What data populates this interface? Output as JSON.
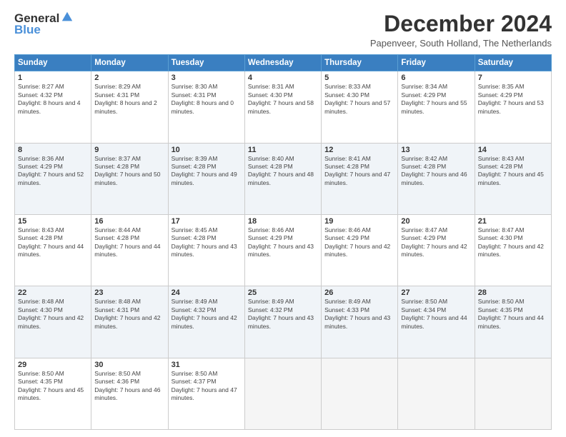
{
  "header": {
    "logo": {
      "general": "General",
      "blue": "Blue"
    },
    "title": "December 2024",
    "location": "Papenveer, South Holland, The Netherlands"
  },
  "calendar": {
    "days_of_week": [
      "Sunday",
      "Monday",
      "Tuesday",
      "Wednesday",
      "Thursday",
      "Friday",
      "Saturday"
    ],
    "weeks": [
      [
        null,
        {
          "day": "2",
          "sunrise": "Sunrise: 8:29 AM",
          "sunset": "Sunset: 4:31 PM",
          "daylight": "Daylight: 8 hours and 2 minutes."
        },
        {
          "day": "3",
          "sunrise": "Sunrise: 8:30 AM",
          "sunset": "Sunset: 4:31 PM",
          "daylight": "Daylight: 8 hours and 0 minutes."
        },
        {
          "day": "4",
          "sunrise": "Sunrise: 8:31 AM",
          "sunset": "Sunset: 4:30 PM",
          "daylight": "Daylight: 7 hours and 58 minutes."
        },
        {
          "day": "5",
          "sunrise": "Sunrise: 8:33 AM",
          "sunset": "Sunset: 4:30 PM",
          "daylight": "Daylight: 7 hours and 57 minutes."
        },
        {
          "day": "6",
          "sunrise": "Sunrise: 8:34 AM",
          "sunset": "Sunset: 4:29 PM",
          "daylight": "Daylight: 7 hours and 55 minutes."
        },
        {
          "day": "7",
          "sunrise": "Sunrise: 8:35 AM",
          "sunset": "Sunset: 4:29 PM",
          "daylight": "Daylight: 7 hours and 53 minutes."
        }
      ],
      [
        {
          "day": "8",
          "sunrise": "Sunrise: 8:36 AM",
          "sunset": "Sunset: 4:29 PM",
          "daylight": "Daylight: 7 hours and 52 minutes."
        },
        {
          "day": "9",
          "sunrise": "Sunrise: 8:37 AM",
          "sunset": "Sunset: 4:28 PM",
          "daylight": "Daylight: 7 hours and 50 minutes."
        },
        {
          "day": "10",
          "sunrise": "Sunrise: 8:39 AM",
          "sunset": "Sunset: 4:28 PM",
          "daylight": "Daylight: 7 hours and 49 minutes."
        },
        {
          "day": "11",
          "sunrise": "Sunrise: 8:40 AM",
          "sunset": "Sunset: 4:28 PM",
          "daylight": "Daylight: 7 hours and 48 minutes."
        },
        {
          "day": "12",
          "sunrise": "Sunrise: 8:41 AM",
          "sunset": "Sunset: 4:28 PM",
          "daylight": "Daylight: 7 hours and 47 minutes."
        },
        {
          "day": "13",
          "sunrise": "Sunrise: 8:42 AM",
          "sunset": "Sunset: 4:28 PM",
          "daylight": "Daylight: 7 hours and 46 minutes."
        },
        {
          "day": "14",
          "sunrise": "Sunrise: 8:43 AM",
          "sunset": "Sunset: 4:28 PM",
          "daylight": "Daylight: 7 hours and 45 minutes."
        }
      ],
      [
        {
          "day": "15",
          "sunrise": "Sunrise: 8:43 AM",
          "sunset": "Sunset: 4:28 PM",
          "daylight": "Daylight: 7 hours and 44 minutes."
        },
        {
          "day": "16",
          "sunrise": "Sunrise: 8:44 AM",
          "sunset": "Sunset: 4:28 PM",
          "daylight": "Daylight: 7 hours and 44 minutes."
        },
        {
          "day": "17",
          "sunrise": "Sunrise: 8:45 AM",
          "sunset": "Sunset: 4:28 PM",
          "daylight": "Daylight: 7 hours and 43 minutes."
        },
        {
          "day": "18",
          "sunrise": "Sunrise: 8:46 AM",
          "sunset": "Sunset: 4:29 PM",
          "daylight": "Daylight: 7 hours and 43 minutes."
        },
        {
          "day": "19",
          "sunrise": "Sunrise: 8:46 AM",
          "sunset": "Sunset: 4:29 PM",
          "daylight": "Daylight: 7 hours and 42 minutes."
        },
        {
          "day": "20",
          "sunrise": "Sunrise: 8:47 AM",
          "sunset": "Sunset: 4:29 PM",
          "daylight": "Daylight: 7 hours and 42 minutes."
        },
        {
          "day": "21",
          "sunrise": "Sunrise: 8:47 AM",
          "sunset": "Sunset: 4:30 PM",
          "daylight": "Daylight: 7 hours and 42 minutes."
        }
      ],
      [
        {
          "day": "22",
          "sunrise": "Sunrise: 8:48 AM",
          "sunset": "Sunset: 4:30 PM",
          "daylight": "Daylight: 7 hours and 42 minutes."
        },
        {
          "day": "23",
          "sunrise": "Sunrise: 8:48 AM",
          "sunset": "Sunset: 4:31 PM",
          "daylight": "Daylight: 7 hours and 42 minutes."
        },
        {
          "day": "24",
          "sunrise": "Sunrise: 8:49 AM",
          "sunset": "Sunset: 4:32 PM",
          "daylight": "Daylight: 7 hours and 42 minutes."
        },
        {
          "day": "25",
          "sunrise": "Sunrise: 8:49 AM",
          "sunset": "Sunset: 4:32 PM",
          "daylight": "Daylight: 7 hours and 43 minutes."
        },
        {
          "day": "26",
          "sunrise": "Sunrise: 8:49 AM",
          "sunset": "Sunset: 4:33 PM",
          "daylight": "Daylight: 7 hours and 43 minutes."
        },
        {
          "day": "27",
          "sunrise": "Sunrise: 8:50 AM",
          "sunset": "Sunset: 4:34 PM",
          "daylight": "Daylight: 7 hours and 44 minutes."
        },
        {
          "day": "28",
          "sunrise": "Sunrise: 8:50 AM",
          "sunset": "Sunset: 4:35 PM",
          "daylight": "Daylight: 7 hours and 44 minutes."
        }
      ],
      [
        {
          "day": "29",
          "sunrise": "Sunrise: 8:50 AM",
          "sunset": "Sunset: 4:35 PM",
          "daylight": "Daylight: 7 hours and 45 minutes."
        },
        {
          "day": "30",
          "sunrise": "Sunrise: 8:50 AM",
          "sunset": "Sunset: 4:36 PM",
          "daylight": "Daylight: 7 hours and 46 minutes."
        },
        {
          "day": "31",
          "sunrise": "Sunrise: 8:50 AM",
          "sunset": "Sunset: 4:37 PM",
          "daylight": "Daylight: 7 hours and 47 minutes."
        },
        null,
        null,
        null,
        null
      ]
    ],
    "first_day_num": {
      "day": "1",
      "sunrise": "Sunrise: 8:27 AM",
      "sunset": "Sunset: 4:32 PM",
      "daylight": "Daylight: 8 hours and 4 minutes."
    }
  }
}
